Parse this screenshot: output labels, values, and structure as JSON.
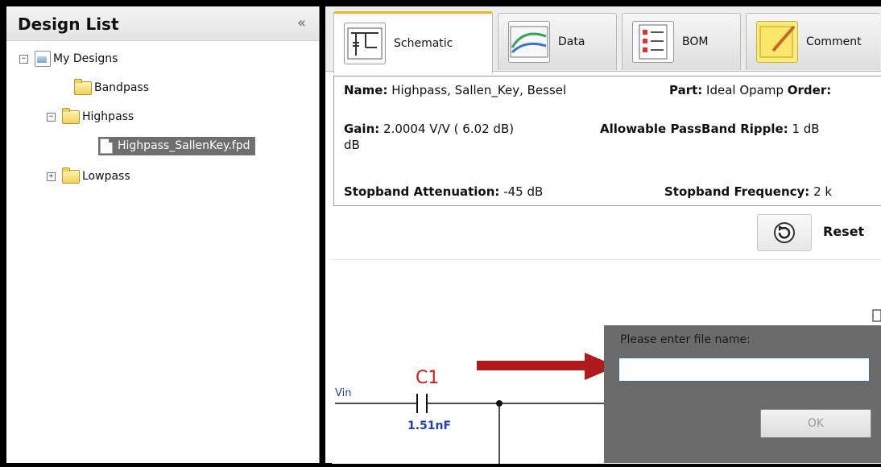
{
  "left_panel": {
    "title": "Design List",
    "collapse": "«",
    "tree": {
      "root": {
        "label": "My Designs",
        "toggle": "−"
      },
      "items": [
        {
          "label": "Bandpass"
        },
        {
          "label": "Highpass",
          "toggle": "−"
        },
        {
          "label": "Highpass_SallenKey.fpd"
        },
        {
          "label": "Lowpass",
          "toggle": "+"
        }
      ]
    }
  },
  "tabs": [
    {
      "label": "Schematic",
      "icon": "schematic-icon"
    },
    {
      "label": "Data",
      "icon": "data-chart-icon"
    },
    {
      "label": "BOM",
      "icon": "bom-list-icon"
    },
    {
      "label": "Comment",
      "icon": "comment-notepad-icon"
    }
  ],
  "info": {
    "name_label": "Name:",
    "name_value": " Highpass, Sallen_Key, Bessel",
    "part_label": "Part:",
    "part_value": " Ideal Opamp ",
    "order_label": "Order:",
    "gain_label": "Gain:",
    "gain_value": " 2.0004 V/V ( 6.02 dB)",
    "gain_unit_wrap": "dB",
    "ripple_label": "Allowable PassBand Ripple:",
    "ripple_value": " 1 dB",
    "stop_atten_label": "Stopband Attenuation:",
    "stop_atten_value": " -45 dB",
    "stop_freq_label": "Stopband Frequency:",
    "stop_freq_value": " 2 k"
  },
  "reset": {
    "label": "Reset",
    "icon": "reset-icon"
  },
  "schematic": {
    "vin_label": "Vin",
    "capacitor_name": "C1",
    "capacitor_value": "1.51nF"
  },
  "dialog": {
    "prompt": "Please enter file name:",
    "input_value": "",
    "ok_label": "OK"
  },
  "colors": {
    "annotation_arrow": "#b01a1a",
    "dialog_bg": "#6b6b6b",
    "active_tab_accent": "#f0b429",
    "cap_label": "#d11a1a",
    "cap_value": "#1f3fb8"
  }
}
